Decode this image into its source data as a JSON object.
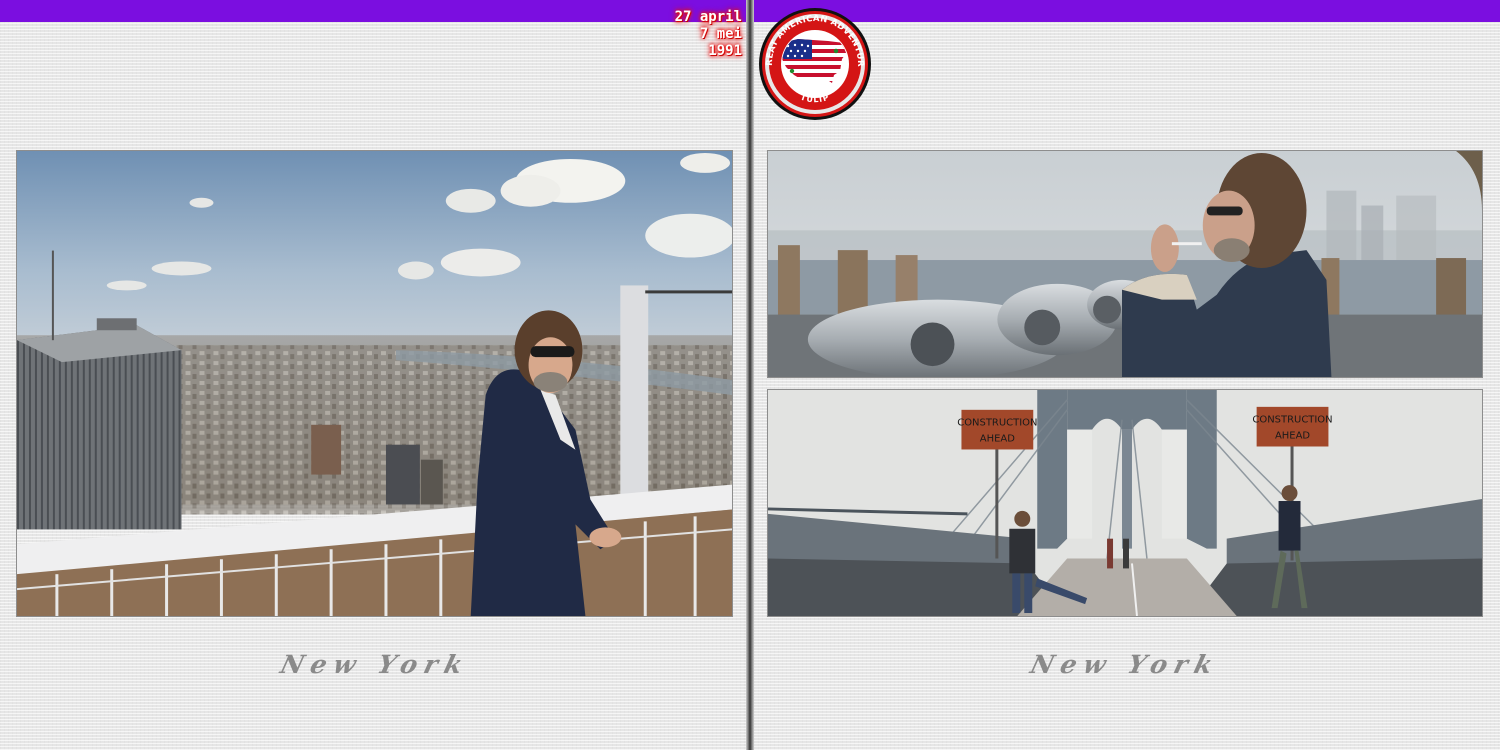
{
  "header": {
    "date_lines": [
      "27 april",
      "7 mei",
      "1991"
    ]
  },
  "badge": {
    "top_text": "GREAT AMERICAN ADVENTURE",
    "bottom_text": "TULIP",
    "icon": "usa-flag-map-icon"
  },
  "left_page": {
    "caption": "New York",
    "photo_icon": "observation-deck-photo"
  },
  "right_page": {
    "caption": "New York",
    "photos": [
      {
        "icon": "binoculars-photo"
      },
      {
        "icon": "brooklyn-bridge-photo",
        "signs": [
          "CONSTRUCTION",
          "AHEAD"
        ]
      }
    ]
  },
  "colors": {
    "top_bar": "#7b0ee0",
    "date_glow": "#e01010",
    "badge_ring": "#d41515",
    "caption": "#8a8a8a"
  }
}
